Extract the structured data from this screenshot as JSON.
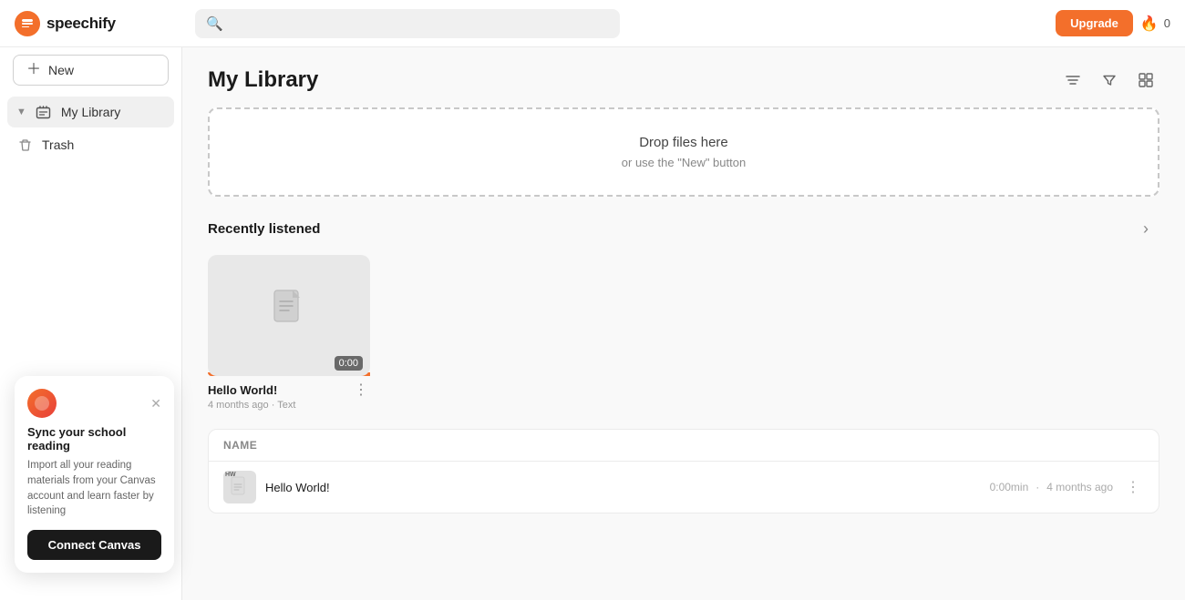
{
  "app": {
    "logo_text": "speechify",
    "search_placeholder": ""
  },
  "sidebar": {
    "new_button_label": "New",
    "items": [
      {
        "id": "my-library",
        "label": "My Library",
        "active": true
      },
      {
        "id": "trash",
        "label": "Trash",
        "active": false
      }
    ]
  },
  "top_bar": {
    "upgrade_label": "Upgrade",
    "credits_count": "0"
  },
  "main": {
    "page_title": "My Library",
    "drop_zone": {
      "title": "Drop files here",
      "subtitle": "or use the \"New\" button"
    },
    "recently_listened": {
      "section_title": "Recently listened",
      "card": {
        "name": "Hello World!",
        "duration": "0:00",
        "meta": "4 months ago",
        "type": "Text"
      }
    },
    "file_list": {
      "column_name": "Name",
      "rows": [
        {
          "name": "Hello World!",
          "duration": "0:00min",
          "ago": "4 months ago",
          "type": "HW"
        }
      ]
    }
  },
  "canvas_popup": {
    "title": "Sync your school reading",
    "description": "Import all your reading materials from your Canvas account and learn faster by listening",
    "connect_label": "Connect Canvas"
  }
}
